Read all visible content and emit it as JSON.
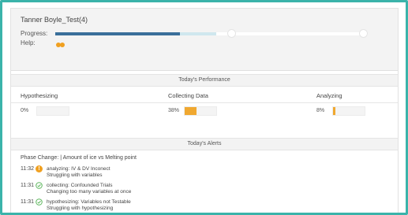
{
  "student": {
    "name": "Tanner Boyle_Test(4)",
    "progress_label": "Progress:",
    "help_label": "Help:",
    "progress_fraction": 0.5,
    "help_count": 2
  },
  "performance": {
    "header": "Today's Performance",
    "columns": [
      {
        "title": "Hypothesizing",
        "pct_label": "0%",
        "value": 0
      },
      {
        "title": "Collecting Data",
        "pct_label": "38%",
        "value": 38
      },
      {
        "title": "Analyzing",
        "pct_label": "8%",
        "value": 8
      }
    ]
  },
  "alerts": {
    "header": "Today's Alerts",
    "phase": "Phase Change: | Amount of ice vs Melting point",
    "items": [
      {
        "time": "11:32",
        "status": "warning",
        "icon": "warning-icon",
        "line1": "analyzing: IV & DV Inconect",
        "line2": "Struggling with variables"
      },
      {
        "time": "11:31",
        "status": "resolved",
        "icon": "check-circle-icon",
        "line1": "collecting: Confounded Trials",
        "line2": "Changing too many variables at once"
      },
      {
        "time": "11:31",
        "status": "resolved",
        "icon": "check-circle-icon",
        "line1": "hypothesizing: Variables not Testable",
        "line2": "Struggling with hypothesizing"
      }
    ]
  },
  "colors": {
    "frame": "#3bb3aa",
    "progress": "#3a6f9a",
    "progress_light": "#cfe7ee",
    "bar_fill": "#f0a830",
    "warning": "#f0a020",
    "resolved": "#5bb55b"
  }
}
